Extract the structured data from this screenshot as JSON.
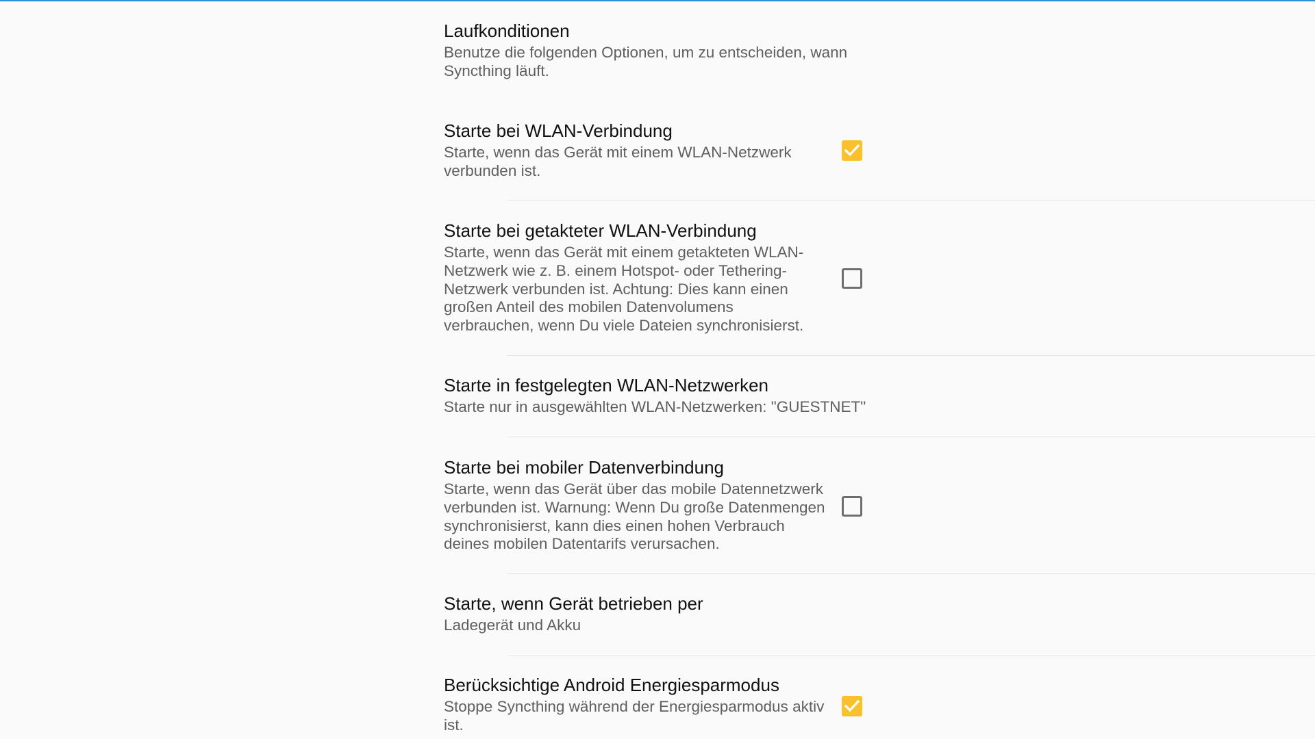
{
  "header": {
    "title": "Laufkonditionen",
    "summary": "Benutze die folgenden Optionen, um zu entscheiden, wann Syncthing läuft."
  },
  "preferences": [
    {
      "title": "Starte bei WLAN-Verbindung",
      "summary": "Starte, wenn das Gerät mit einem WLAN-Netzwerk verbunden ist.",
      "checked": true
    },
    {
      "title": "Starte bei getakteter WLAN-Verbindung",
      "summary": "Starte, wenn das Gerät mit einem getakteten WLAN-Netzwerk wie z. B. einem Hotspot- oder Tethering-Netzwerk verbunden ist. Achtung: Dies kann einen großen Anteil des mobilen Datenvolumens verbrauchen, wenn Du viele Dateien synchronisierst.",
      "checked": false
    },
    {
      "title": "Starte in festgelegten WLAN-Netzwerken",
      "summary": "Starte nur in ausgewählten WLAN-Netzwerken: \"GUESTNET\""
    },
    {
      "title": "Starte bei mobiler Datenverbindung",
      "summary": "Starte, wenn das Gerät über das mobile Datennetzwerk verbunden ist. Warnung: Wenn Du große Datenmengen synchronisierst, kann dies einen hohen Verbrauch deines mobilen Datentarifs verursachen.",
      "checked": false
    },
    {
      "title": "Starte, wenn Gerät betrieben per",
      "summary": "Ladegerät und Akku"
    },
    {
      "title": "Berücksichtige Android Energiesparmodus",
      "summary": "Stoppe Syncthing während der Energiesparmodus aktiv ist.",
      "checked": true
    }
  ],
  "colors": {
    "accent": "#fbc02d",
    "top_line": "#2a8fd6",
    "title_text": "#111111",
    "summary_text": "#5f5f5f",
    "divider": "#e4e4e4",
    "background": "#fafafa"
  },
  "icons": {
    "checkbox_checked": "check-icon"
  }
}
